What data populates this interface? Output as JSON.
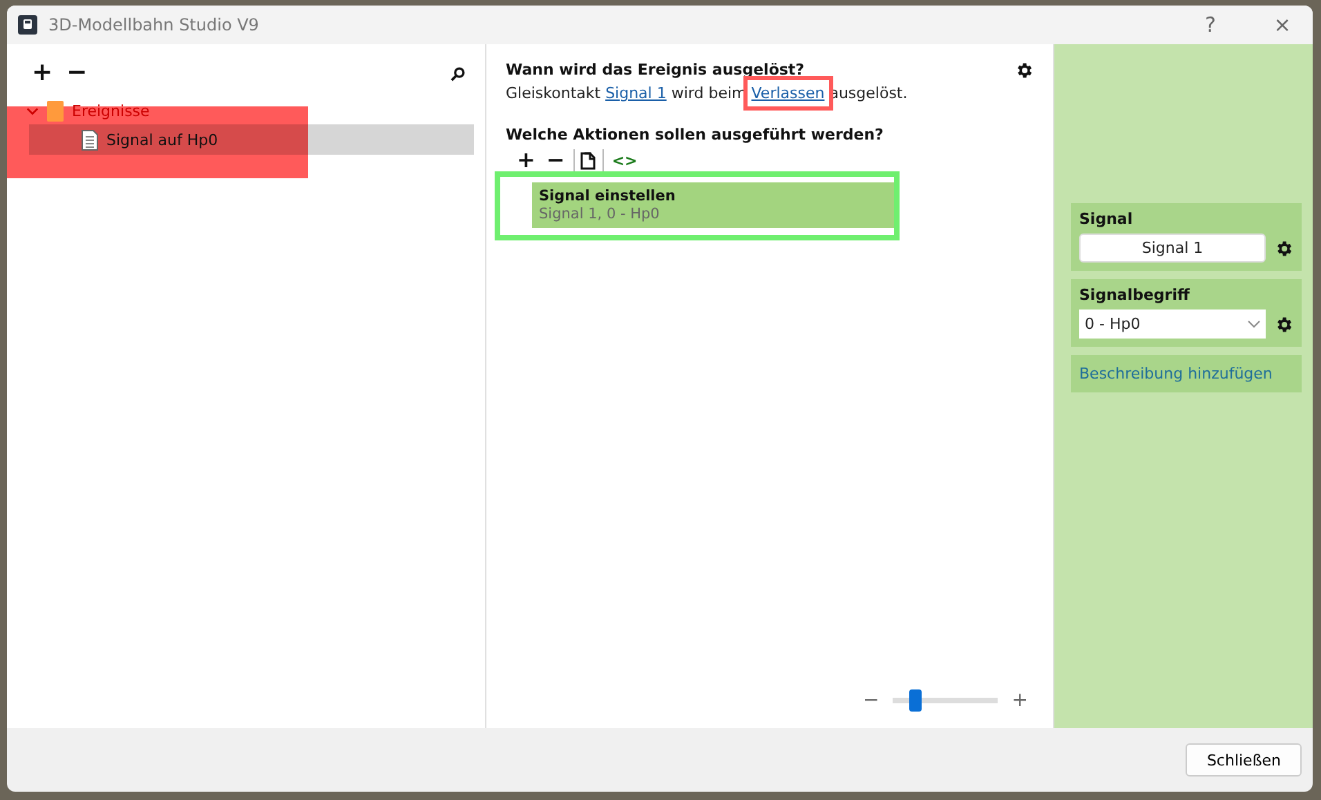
{
  "window": {
    "title": "3D-Modellbahn Studio V9",
    "help": "?",
    "close": "×"
  },
  "tree": {
    "add": "+",
    "remove": "−",
    "items": [
      {
        "label": "Ereignisse",
        "expanded": true,
        "selected": false,
        "children": [
          {
            "label": "Signal auf Hp0",
            "selected": true
          }
        ]
      }
    ]
  },
  "trigger": {
    "heading": "Wann wird das Ereignis ausgelöst?",
    "parts": [
      {
        "kind": "text",
        "text": "Gleiskontakt "
      },
      {
        "kind": "link",
        "text": "Signal 1"
      },
      {
        "kind": "text",
        "text": " wird beim "
      },
      {
        "kind": "link",
        "text": "Verlassen"
      },
      {
        "kind": "text",
        "text": " ausgelöst."
      }
    ]
  },
  "actions": {
    "heading": "Welche Aktionen sollen ausgeführt werden?",
    "toolbar": {
      "add": "+",
      "remove": "−",
      "code": "<>"
    },
    "items": [
      {
        "title": "Signal einstellen",
        "detail": "Signal 1, 0 - Hp0",
        "selected": true
      }
    ]
  },
  "zoom": {
    "minus": "−",
    "plus": "+",
    "level": 0.15
  },
  "properties": [
    {
      "kind": "button",
      "label": "Signal",
      "value": "Signal 1"
    },
    {
      "kind": "select",
      "label": "Signalbegriff",
      "value": "0 - Hp0"
    },
    {
      "kind": "link",
      "value": "Beschreibung hinzufügen"
    }
  ],
  "footer": {
    "close_button": "Schließen"
  },
  "highlights": [
    {
      "color": "#ff5a5a"
    },
    {
      "color": "#ff5a5a"
    },
    {
      "color": "#6fef6f"
    }
  ]
}
